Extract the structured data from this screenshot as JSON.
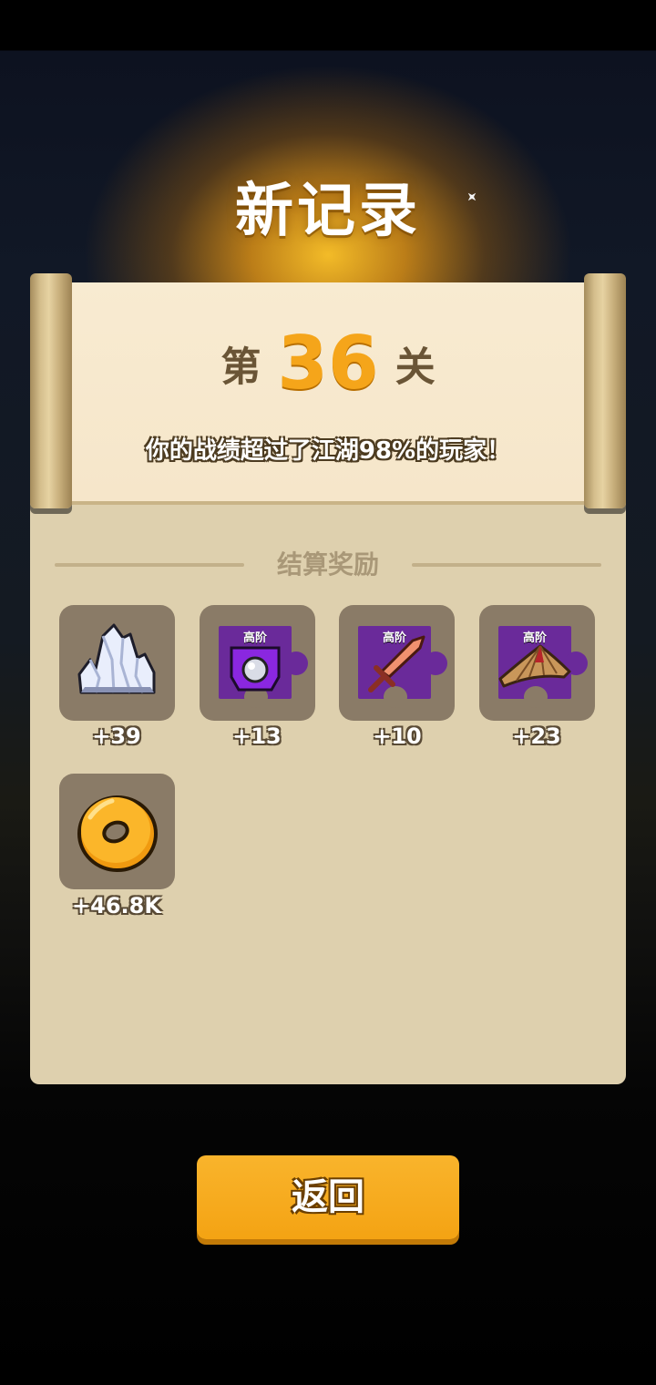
{
  "header": {
    "title": "新记录"
  },
  "level": {
    "prefix": "第",
    "number": "36",
    "suffix": "关",
    "rank_text": "你的战绩超过了江湖98%的玩家！"
  },
  "rewards": {
    "title": "结算奖励",
    "items": [
      {
        "icon": "crystal-icon",
        "amount": "+39"
      },
      {
        "icon": "shield-fragment-icon",
        "tier": "高阶",
        "amount": "+13"
      },
      {
        "icon": "sword-fragment-icon",
        "tier": "高阶",
        "amount": "+10"
      },
      {
        "icon": "hat-fragment-icon",
        "tier": "高阶",
        "amount": "+23"
      },
      {
        "icon": "coin-icon",
        "amount": "+46.8K"
      }
    ]
  },
  "actions": {
    "back_label": "返回"
  },
  "colors": {
    "accent": "#f5a51a",
    "panel": "#ded0ae",
    "paper": "#f8ebd1",
    "fragment": "#6a2a9a"
  }
}
